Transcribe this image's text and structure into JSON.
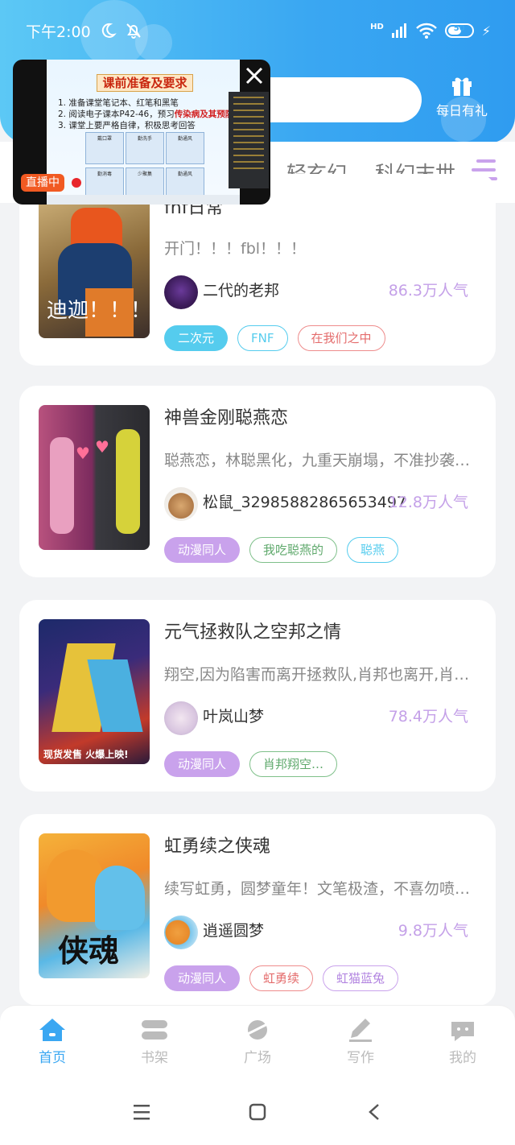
{
  "status_bar": {
    "time": "下午2:00",
    "network": "HD",
    "battery": "50"
  },
  "header": {
    "daily_gift_label": "每日有礼"
  },
  "live_popup": {
    "badge": "直播中",
    "slide_title": "课前准备及要求",
    "line1": "1. 准备课堂笔记本、红笔和黑笔",
    "line2_prefix": "2. 阅读电子课本P42-46，预习",
    "line2_highlight": "传染病及其预防",
    "line3": "3. 课堂上要严格自律，积极思考回答",
    "grid_labels": [
      "戴口罩",
      "勤洗手",
      "勤消毒",
      "勤通风",
      "少聚集",
      "勤通风"
    ]
  },
  "tabs": {
    "tab1": "轻玄幻",
    "tab2": "科幻末世"
  },
  "cards": [
    {
      "title": "fnf日常",
      "desc": "开门！！！fbl！！！",
      "author": "二代的老邦",
      "popularity": "86.3万人气",
      "cover_text": "迪迦！！！",
      "tags": [
        "二次元",
        "FNF",
        "在我们之中"
      ]
    },
    {
      "title": "神兽金刚聪燕恋",
      "desc": "聪燕恋，林聪黑化，九重天崩塌，不准抄袭！！！",
      "author": "松鼠_32985882865653497",
      "popularity": "12.8万人气",
      "tags": [
        "动漫同人",
        "我吃聪燕的",
        "聪燕"
      ]
    },
    {
      "title": "元气拯救队之空邦之情",
      "desc": "翔空,因为陷害而离开拯救队,肖邦也离开,肖…",
      "author": "叶岚山梦",
      "popularity": "78.4万人气",
      "cover_text": "现货发售 火爆上映!",
      "tags": [
        "动漫同人",
        "肖邦翔空…"
      ]
    },
    {
      "title": "虹勇续之侠魂",
      "desc": "续写虹勇，圆梦童年！文笔极渣，不喜勿喷哈…",
      "author": "逍遥圆梦",
      "popularity": "9.8万人气",
      "cover_text": "侠魂",
      "tags": [
        "动漫同人",
        "虹勇续",
        "虹猫蓝兔"
      ]
    }
  ],
  "bottom_nav": [
    "首页",
    "书架",
    "广场",
    "写作",
    "我的"
  ],
  "colors": {
    "accent": "#3aa7f2",
    "popularity": "#c4a0e8"
  }
}
